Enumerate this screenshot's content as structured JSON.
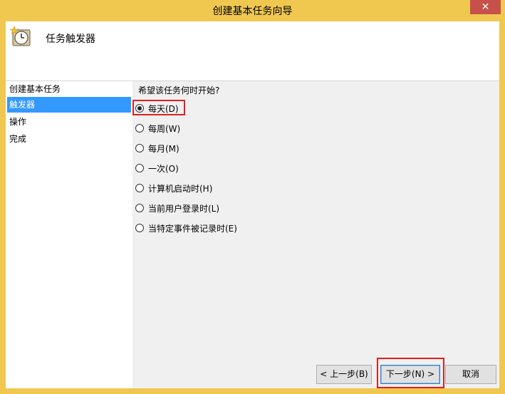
{
  "window": {
    "title": "创建基本任务向导",
    "close_label": "✕"
  },
  "header": {
    "icon": "clock-task-icon",
    "title": "任务触发器"
  },
  "nav": {
    "items": [
      {
        "label": "创建基本任务",
        "selected": false
      },
      {
        "label": "触发器",
        "selected": true
      },
      {
        "label": "操作",
        "selected": false
      },
      {
        "label": "完成",
        "selected": false
      }
    ]
  },
  "main": {
    "question": "希望该任务何时开始?",
    "options": [
      {
        "label": "每天(D)",
        "checked": true
      },
      {
        "label": "每周(W)",
        "checked": false
      },
      {
        "label": "每月(M)",
        "checked": false
      },
      {
        "label": "一次(O)",
        "checked": false
      },
      {
        "label": "计算机启动时(H)",
        "checked": false
      },
      {
        "label": "当前用户登录时(L)",
        "checked": false
      },
      {
        "label": "当特定事件被记录时(E)",
        "checked": false
      }
    ]
  },
  "buttons": {
    "back": "< 上一步(B)",
    "next": "下一步(N) >",
    "cancel": "取消"
  },
  "colors": {
    "frame": "#f0c850",
    "selection": "#3399ff",
    "highlight": "#e02020"
  }
}
